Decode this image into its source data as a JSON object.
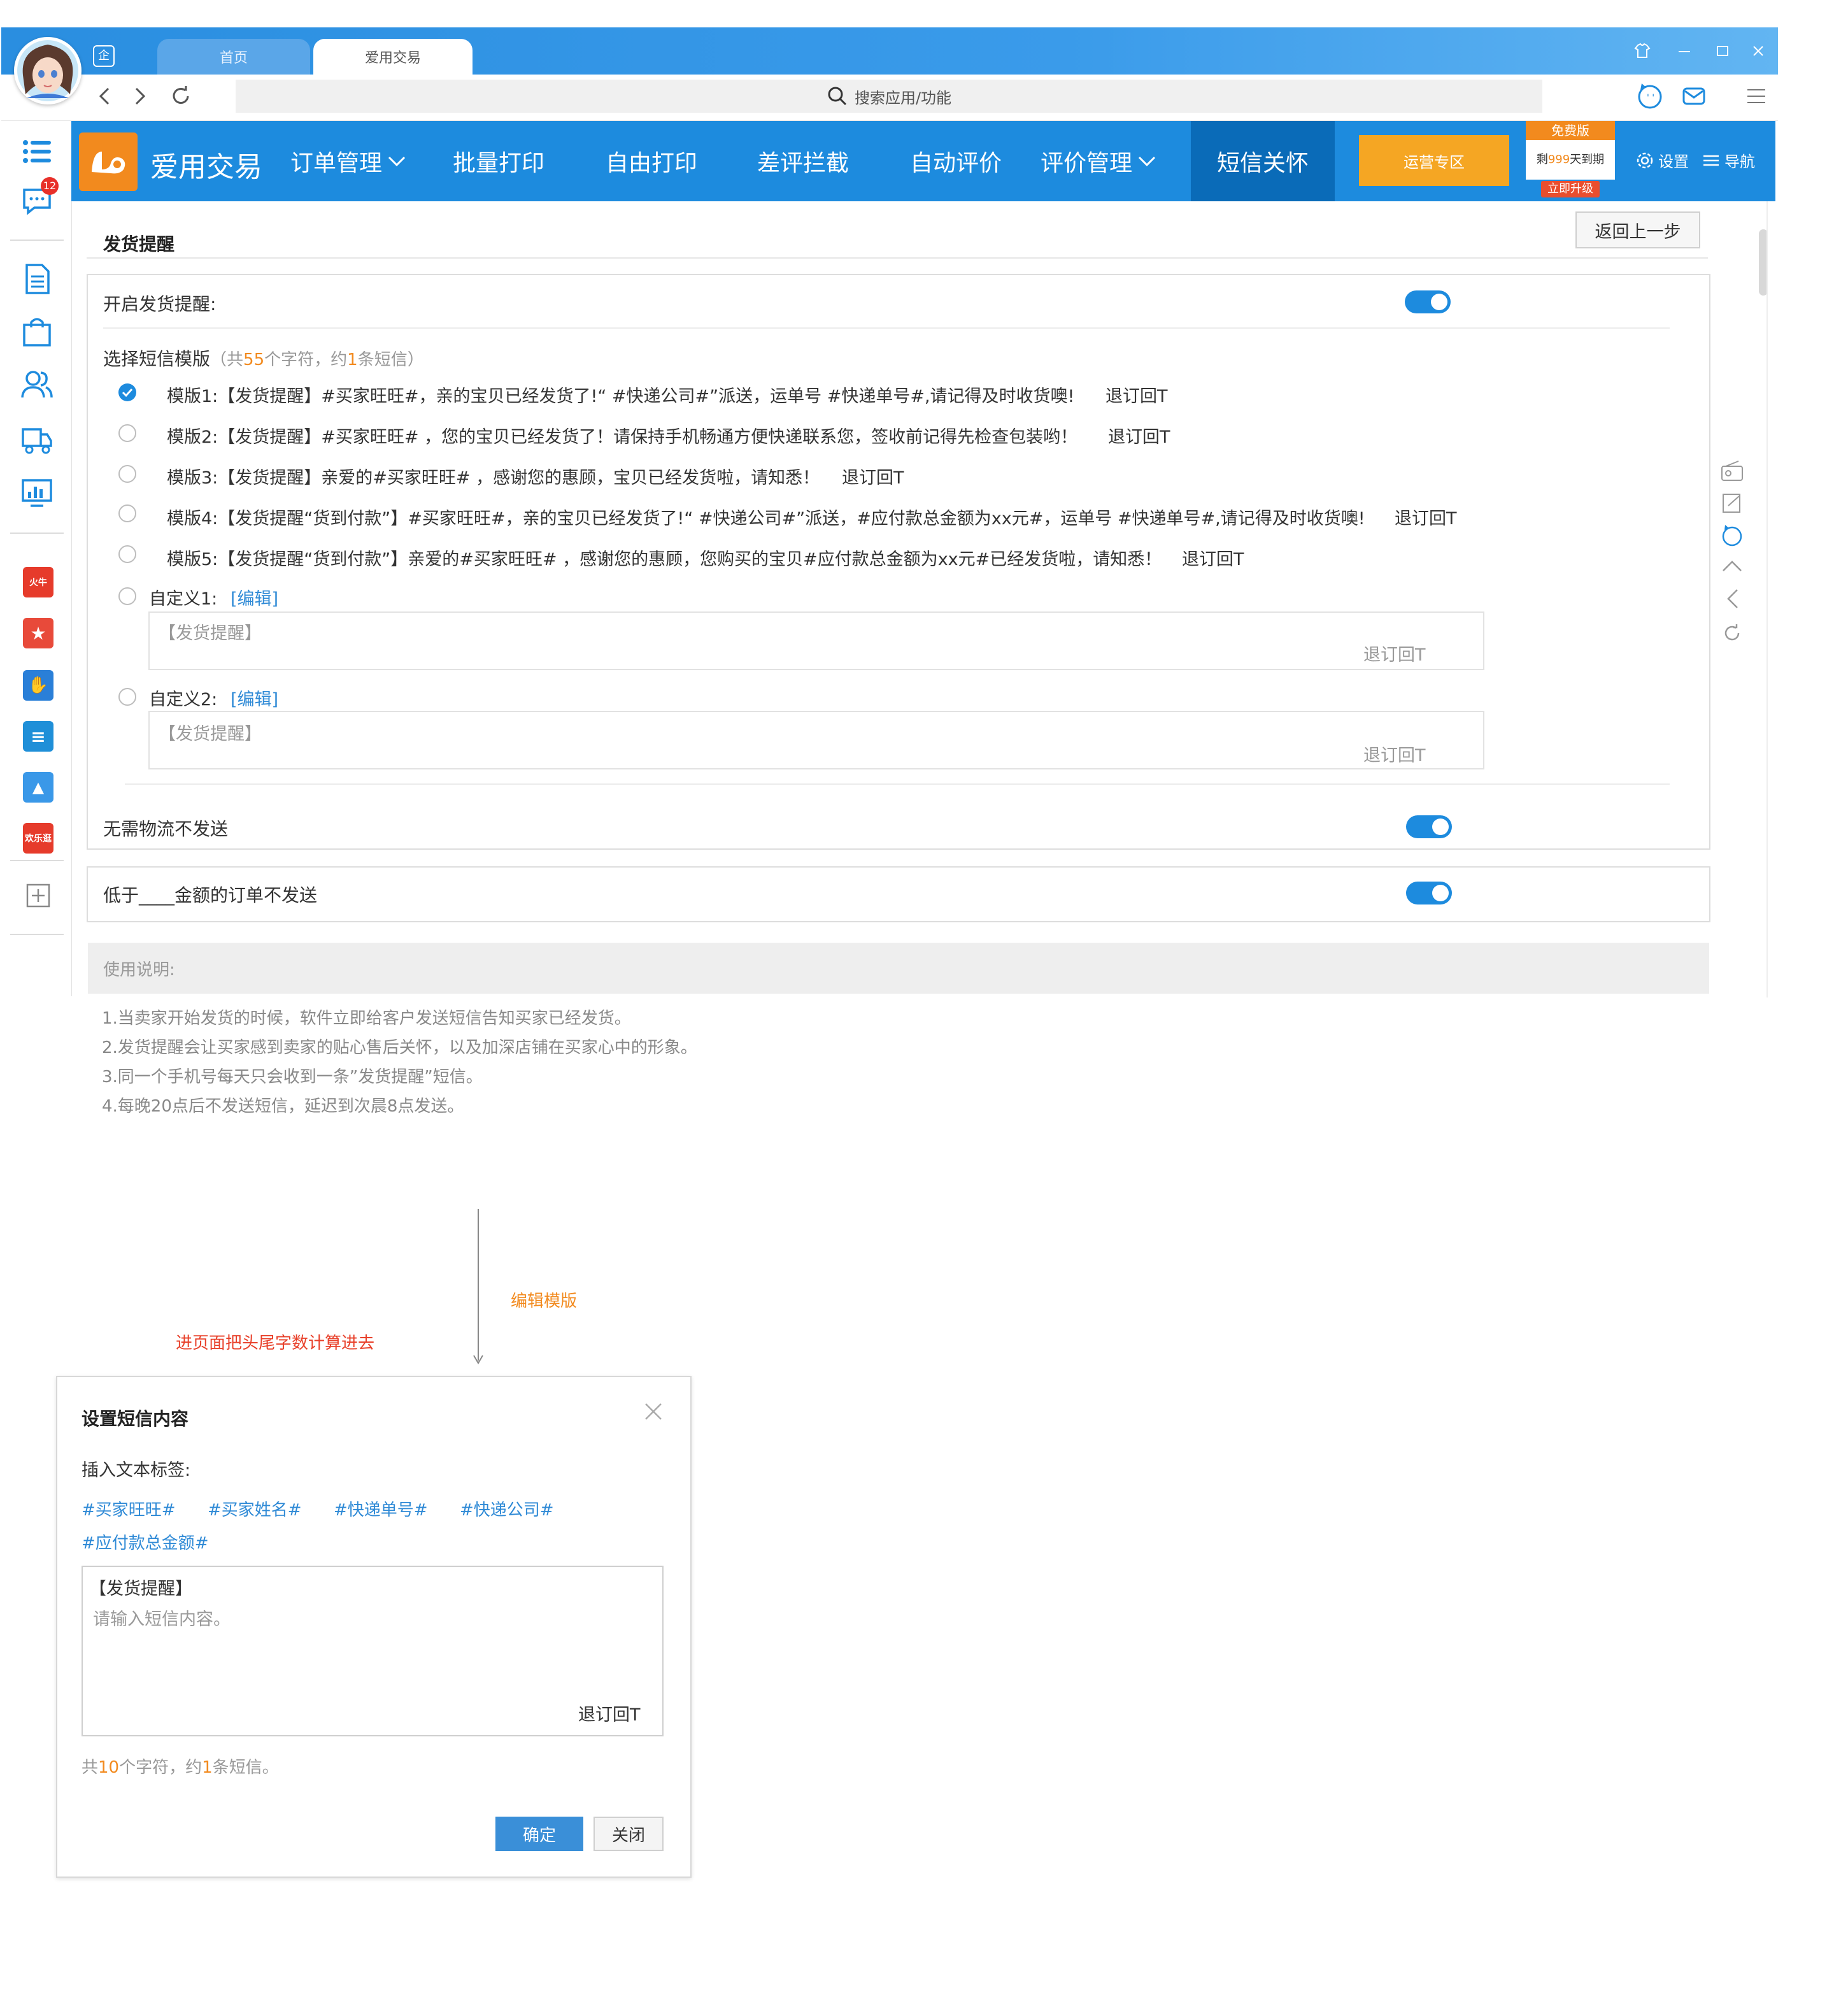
{
  "browser": {
    "tabs": [
      {
        "label": "首页"
      },
      {
        "label": "爱用交易"
      }
    ],
    "search_placeholder": "搜索应用/功能",
    "avatar_badge": "企"
  },
  "sidebar": {
    "message_badge": "12",
    "apps": [
      {
        "label": "火牛",
        "color": "#e63b2b"
      },
      {
        "label": "★",
        "color": "#e84a3a"
      },
      {
        "label": "✋",
        "color": "#2a7fd8"
      },
      {
        "label": "≡",
        "color": "#1f8fd8"
      },
      {
        "label": "▲",
        "color": "#3a98e8"
      },
      {
        "label": "欢乐逛",
        "color": "#e63b2b"
      }
    ]
  },
  "topnav": {
    "brand": "爱用交易",
    "items": [
      {
        "label": "订单管理",
        "dropdown": true
      },
      {
        "label": "批量打印",
        "dropdown": false
      },
      {
        "label": "自由打印",
        "dropdown": false
      },
      {
        "label": "差评拦截",
        "dropdown": false
      },
      {
        "label": "自动评价",
        "dropdown": false
      },
      {
        "label": "评价管理",
        "dropdown": true
      },
      {
        "label": "短信关怀",
        "dropdown": false,
        "active": true
      }
    ],
    "ops_zone": "运营专区",
    "free_badge": {
      "title": "免费版",
      "remaining_prefix": "剩",
      "remaining_days": "999",
      "remaining_suffix": "天到期",
      "upgrade": "立即升级"
    },
    "settings": "设置",
    "navigation": "导航"
  },
  "page": {
    "title": "发货提醒",
    "back_button": "返回上一步",
    "enable_label": "开启发货提醒:",
    "enable_on": true,
    "select_template_label": "选择短信模版",
    "count_prefix": "（共",
    "count_chars": "55",
    "count_mid": "个字符，约",
    "count_sms": "1",
    "count_suffix": "条短信）",
    "templates": [
      {
        "text": "模版1:【发货提醒】#买家旺旺#，亲的宝贝已经发货了!“ #快递公司#”派送，运单号 #快递单号#,请记得及时收货噢!",
        "unsub": "退订回T",
        "checked": true
      },
      {
        "text": "模版2:【发货提醒】#买家旺旺# ，您的宝贝已经发货了！请保持手机畅通方便快递联系您，签收前记得先检查包装哟！",
        "unsub": "退订回T",
        "checked": false
      },
      {
        "text": "模版3:【发货提醒】亲爱的#买家旺旺# ，感谢您的惠顾，宝贝已经发货啦，请知悉！",
        "unsub": "退订回T",
        "checked": false
      },
      {
        "text": "模版4:【发货提醒“货到付款”】#买家旺旺#，亲的宝贝已经发货了!“ #快递公司#”派送，#应付款总金额为xx元#，运单号 #快递单号#,请记得及时收货噢!",
        "unsub": "退订回T",
        "checked": false
      },
      {
        "text": "模版5:【发货提醒“货到付款”】亲爱的#买家旺旺# ，感谢您的惠顾，您购买的宝贝#应付款总金额为xx元#已经发货啦，请知悉！",
        "unsub": "退订回T",
        "checked": false
      }
    ],
    "custom": [
      {
        "label": "自定义1:",
        "edit": "[编辑]",
        "placeholder": "【发货提醒】",
        "unsub": "退订回T"
      },
      {
        "label": "自定义2:",
        "edit": "[编辑]",
        "placeholder": "【发货提醒】",
        "unsub": "退订回T"
      }
    ],
    "no_logistics_label": "无需物流不发送",
    "no_logistics_on": true,
    "below_amount_label": "低于____金额的订单不发送",
    "below_amount_on": true,
    "usage_title": "使用说明:",
    "usage_notes": [
      "1.当卖家开始发货的时候，软件立即给客户发送短信告知买家已经发货。",
      "2.发货提醒会让买家感到卖家的贴心售后关怀，以及加深店铺在买家心中的形象。",
      "3.同一个手机号每天只会收到一条”发货提醒”短信。",
      "4.每晚20点后不发送短信，延迟到次晨8点发送。"
    ]
  },
  "annotations": {
    "edit_template": "编辑模版",
    "count_note": "进页面把头尾字数计算进去"
  },
  "dialog": {
    "title": "设置短信内容",
    "insert_label": "插入文本标签:",
    "tags": [
      "#买家旺旺#",
      "#买家姓名#",
      "#快递单号#",
      "#快递公司#",
      "#应付款总金额#"
    ],
    "prefix": "【发货提醒】",
    "placeholder": "请输入短信内容。",
    "unsub": "退订回T",
    "count_prefix": "共",
    "count_chars": "10",
    "count_mid": "个字符，约",
    "count_sms": "1",
    "count_suffix": "条短信。",
    "confirm": "确定",
    "close": "关闭"
  },
  "colors": {
    "primary": "#1d8bde",
    "orange": "#f5a623",
    "accent_orange": "#f28a1e",
    "red_note": "#e8402a"
  }
}
